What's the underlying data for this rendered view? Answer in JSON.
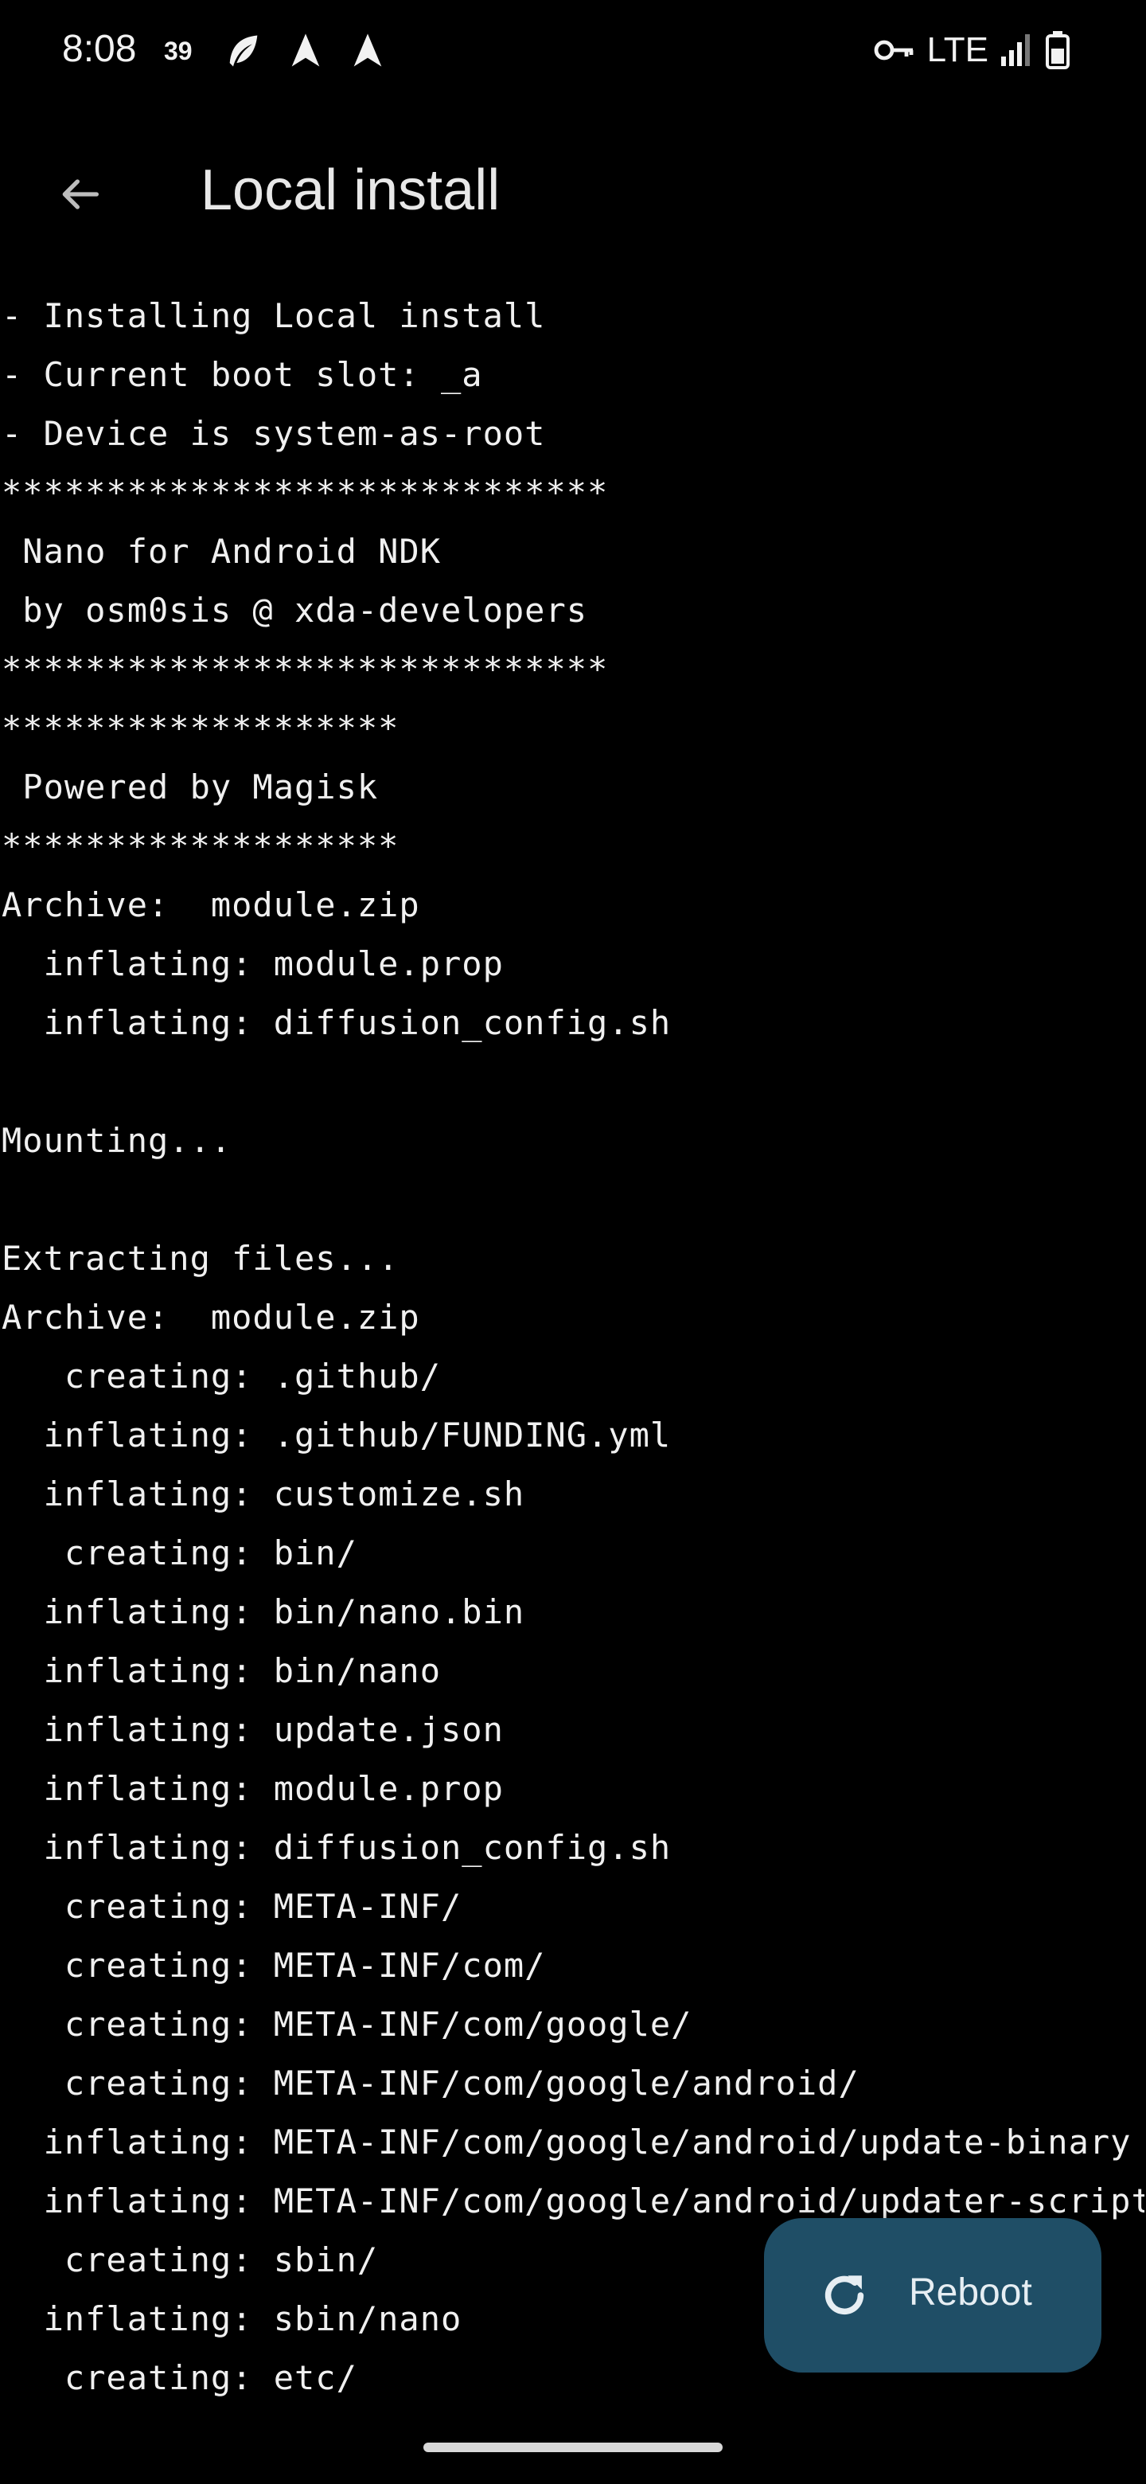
{
  "status_bar": {
    "time": "8:08",
    "notification_count": "39",
    "network": "LTE"
  },
  "header": {
    "title": "Local install"
  },
  "console": {
    "lines": [
      "- Installing Local install",
      "- Current boot slot: _a",
      "- Device is system-as-root",
      "*****************************",
      " Nano for Android NDK",
      " by osm0sis @ xda-developers",
      "*****************************",
      "*******************",
      " Powered by Magisk",
      "*******************",
      "Archive:  module.zip",
      "  inflating: module.prop",
      "  inflating: diffusion_config.sh",
      "",
      "Mounting...",
      "",
      "Extracting files...",
      "Archive:  module.zip",
      "   creating: .github/",
      "  inflating: .github/FUNDING.yml",
      "  inflating: customize.sh",
      "   creating: bin/",
      "  inflating: bin/nano.bin",
      "  inflating: bin/nano",
      "  inflating: update.json",
      "  inflating: module.prop",
      "  inflating: diffusion_config.sh",
      "   creating: META-INF/",
      "   creating: META-INF/com/",
      "   creating: META-INF/com/google/",
      "   creating: META-INF/com/google/android/",
      "  inflating: META-INF/com/google/android/update-binary",
      "  inflating: META-INF/com/google/android/updater-script",
      "   creating: sbin/",
      "  inflating: sbin/nano",
      "   creating: etc/"
    ]
  },
  "fab": {
    "label": "Reboot",
    "icon": "refresh-icon",
    "color": "#1f4e66"
  },
  "icons": {
    "back": "arrow-left-icon",
    "key": "key-icon",
    "signal": "signal-icon",
    "battery": "battery-icon"
  }
}
